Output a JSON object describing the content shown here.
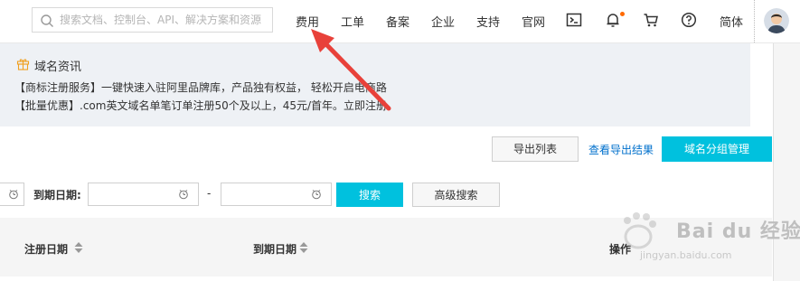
{
  "topbar": {
    "search_placeholder": "搜索文档、控制台、API、解决方案和资源",
    "nav": [
      "费用",
      "工单",
      "备案",
      "企业",
      "支持",
      "官网"
    ],
    "language": "简体",
    "icons": [
      "terminal-icon",
      "bell-icon",
      "cart-icon",
      "help-icon"
    ],
    "notification_dot_color": "#ff6a00"
  },
  "notice": {
    "title": "域名资讯",
    "line1": "【商标注册服务】一键快速入驻阿里品牌库，产品独有权益， 轻松开启电商路",
    "line2": "【批量优惠】.com英文域名单笔订单注册50个及以上，45元/首年。立即注册"
  },
  "actions": {
    "export_list": "导出列表",
    "view_export": "查看导出结果",
    "group_manage": "域名分组管理"
  },
  "filters": {
    "expire_label": "到期日期:",
    "separator": "-",
    "search": "搜索",
    "advanced": "高级搜索"
  },
  "table": {
    "columns": [
      "注册日期",
      "到期日期",
      "操作"
    ]
  },
  "watermark": {
    "brand": "Bai du 经验",
    "url": "jingyan.baidu.com"
  },
  "colors": {
    "primary": "#00c1de",
    "link": "#0070cc",
    "arrow": "#e8413a",
    "notice_bg": "#eef1f5"
  }
}
